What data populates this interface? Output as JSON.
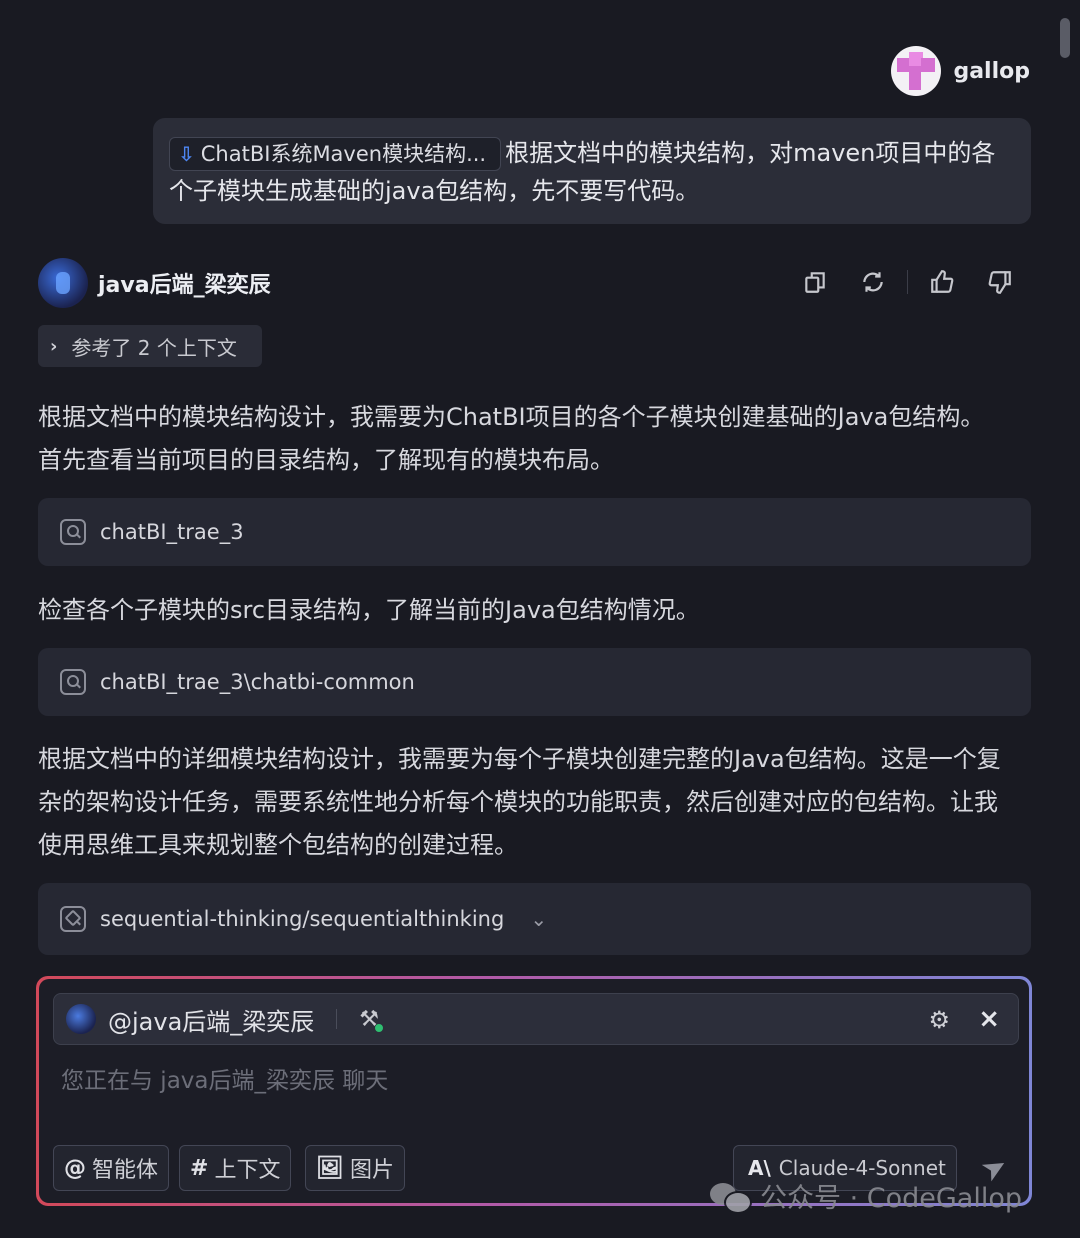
{
  "user": {
    "name": "gallop"
  },
  "user_message": {
    "file_chip": "ChatBI系统Maven模块结构...",
    "text_line1": "根据文档中的模块结构，对maven项目中的各",
    "text_line2": "个子模块生成基础的java包结构，先不要写代码。"
  },
  "agent": {
    "name": "java后端_梁奕辰"
  },
  "context_toggle": "参考了 2 个上下文",
  "messages": {
    "p1_line1": "根据文档中的模块结构设计，我需要为ChatBI项目的各个子模块创建基础的Java包结构。",
    "p1_line2": "首先查看当前项目的目录结构，了解现有的模块布局。",
    "tool1": "chatBI_trae_3",
    "p2": "检查各个子模块的src目录结构，了解当前的Java包结构情况。",
    "tool2": "chatBI_trae_3\\chatbi-common",
    "p3_line1": "根据文档中的详细模块结构设计，我需要为每个子模块创建完整的Java包结构。这是一个复",
    "p3_line2": "杂的架构设计任务，需要系统性地分析每个模块的功能职责，然后创建对应的包结构。让我",
    "p3_line3": "使用思维工具来规划整个包结构的创建过程。",
    "tool3": "sequential-thinking/sequentialthinking"
  },
  "composer": {
    "mention": "@java后端_梁奕辰",
    "placeholder": "您正在与 java后端_梁奕辰 聊天",
    "btn_agent_sym": "@",
    "btn_agent": "智能体",
    "btn_context_sym": "#",
    "btn_context": "上下文",
    "btn_image": "图片",
    "model_logo": "A\\",
    "model": "Claude-4-Sonnet"
  },
  "watermark": "公众号 · CodeGallop"
}
